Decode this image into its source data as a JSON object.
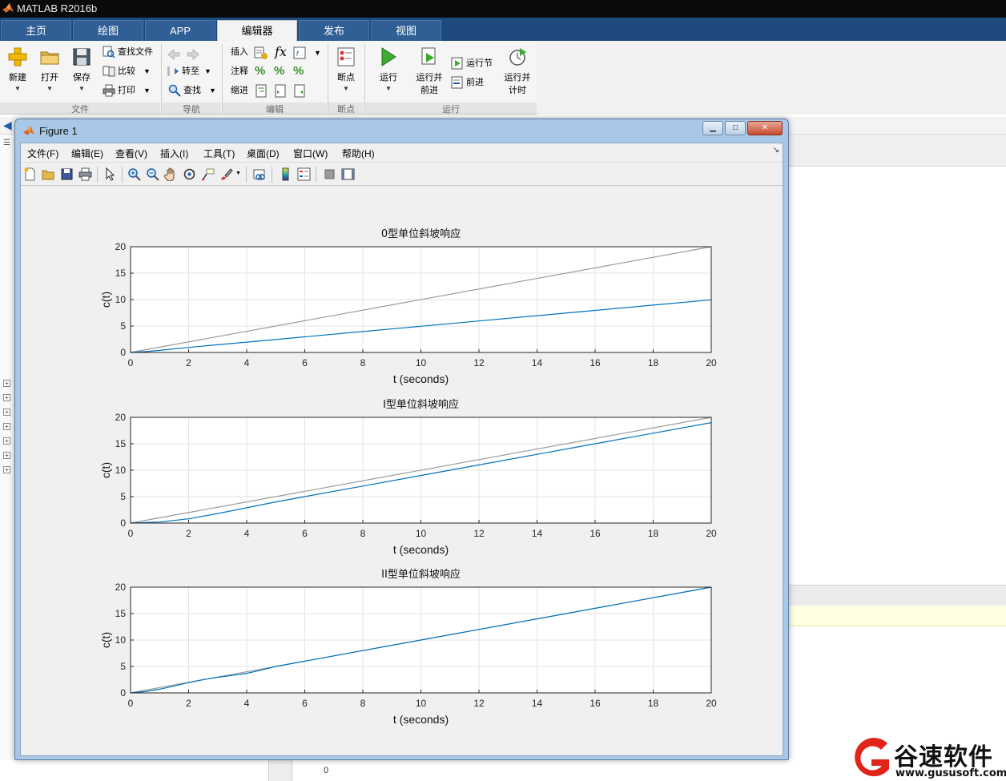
{
  "app": {
    "title": "MATLAB R2016b"
  },
  "ribbon_tabs": [
    {
      "label": "主页",
      "active": false
    },
    {
      "label": "绘图",
      "active": false
    },
    {
      "label": "APP",
      "active": false
    },
    {
      "label": "编辑器",
      "active": true
    },
    {
      "label": "发布",
      "active": false
    },
    {
      "label": "视图",
      "active": false
    }
  ],
  "ribbon": {
    "file": {
      "group": "文件",
      "new": "新建",
      "open": "打开",
      "save": "保存",
      "find_files": "查找文件",
      "compare": "比较",
      "print": "打印"
    },
    "nav": {
      "group": "导航",
      "goto": "转至",
      "find": "查找"
    },
    "edit": {
      "group": "编辑",
      "insert": "插入",
      "comment": "注释",
      "indent": "缩进"
    },
    "breakpoints": {
      "group": "断点",
      "label": "断点"
    },
    "run": {
      "group": "运行",
      "run": "运行",
      "run_advance_1": "运行并",
      "run_advance_2": "前进",
      "run_section": "运行节",
      "advance": "前进",
      "run_time_1": "运行并",
      "run_time_2": "计时"
    }
  },
  "figure": {
    "title": "Figure 1",
    "menu": [
      "文件(F)",
      "编辑(E)",
      "查看(V)",
      "插入(I)",
      "工具(T)",
      "桌面(D)",
      "窗口(W)",
      "帮助(H)"
    ],
    "toolbar_icons": [
      "new-figure-icon",
      "open-file-icon",
      "save-figure-icon",
      "print-figure-icon",
      "edit-plot-icon",
      "zoom-in-icon",
      "zoom-out-icon",
      "pan-icon",
      "rotate-3d-icon",
      "data-cursor-icon",
      "brush-icon",
      "link-plot-icon",
      "insert-colorbar-icon",
      "insert-legend-icon",
      "hide-plot-tools-icon",
      "show-plot-tools-icon"
    ]
  },
  "colors": {
    "series": "#0072bd",
    "reference": "#999999",
    "tab_bar": "#1e4a7d"
  },
  "chart_data": [
    {
      "type": "line",
      "title": "0型单位斜坡响应",
      "xlabel": "t (seconds)",
      "ylabel": "c(t)",
      "xlim": [
        0,
        20
      ],
      "ylim": [
        0,
        20
      ],
      "xticks": [
        0,
        2,
        4,
        6,
        8,
        10,
        12,
        14,
        16,
        18,
        20
      ],
      "yticks": [
        0,
        5,
        10,
        15,
        20
      ],
      "grid": true,
      "series": [
        {
          "x": [
            0,
            20
          ],
          "y": [
            0,
            20
          ]
        },
        {
          "x": [
            0,
            0.5,
            1,
            2,
            4,
            6,
            8,
            10,
            12,
            14,
            16,
            18,
            20
          ],
          "y": [
            0,
            0.15,
            0.4,
            0.95,
            1.95,
            2.95,
            3.95,
            4.95,
            5.95,
            6.95,
            7.95,
            8.95,
            9.95
          ]
        }
      ]
    },
    {
      "type": "line",
      "title": "I型单位斜坡响应",
      "xlabel": "t (seconds)",
      "ylabel": "c(t)",
      "xlim": [
        0,
        20
      ],
      "ylim": [
        0,
        20
      ],
      "xticks": [
        0,
        2,
        4,
        6,
        8,
        10,
        12,
        14,
        16,
        18,
        20
      ],
      "yticks": [
        0,
        5,
        10,
        15,
        20
      ],
      "grid": true,
      "series": [
        {
          "x": [
            0,
            20
          ],
          "y": [
            0,
            20
          ]
        },
        {
          "x": [
            0,
            1,
            2,
            3,
            4,
            5,
            6,
            8,
            10,
            12,
            14,
            16,
            18,
            20
          ],
          "y": [
            0,
            0.2,
            0.8,
            1.8,
            2.9,
            4.0,
            5.0,
            7.0,
            9.0,
            11.0,
            13.0,
            15.0,
            17.0,
            19.0
          ]
        }
      ]
    },
    {
      "type": "line",
      "title": "II型单位斜坡响应",
      "xlabel": "t (seconds)",
      "ylabel": "c(t)",
      "xlim": [
        0,
        20
      ],
      "ylim": [
        0,
        20
      ],
      "xticks": [
        0,
        2,
        4,
        6,
        8,
        10,
        12,
        14,
        16,
        18,
        20
      ],
      "yticks": [
        0,
        5,
        10,
        15,
        20
      ],
      "grid": true,
      "series": [
        {
          "x": [
            0,
            20
          ],
          "y": [
            0,
            20
          ]
        },
        {
          "x": [
            0,
            0.5,
            1,
            1.5,
            2,
            2.5,
            3,
            3.5,
            4,
            4.5,
            5,
            6,
            8,
            10,
            12,
            14,
            16,
            18,
            20
          ],
          "y": [
            0,
            0.25,
            0.7,
            1.3,
            1.95,
            2.5,
            2.95,
            3.3,
            3.7,
            4.3,
            5.0,
            6.0,
            8.0,
            10.0,
            12.0,
            14.0,
            16.0,
            18.0,
            20.0
          ]
        }
      ]
    }
  ],
  "background": {
    "bottom_value": "0"
  },
  "watermark": {
    "text": "谷速软件",
    "url": "www.gususoft.com"
  }
}
